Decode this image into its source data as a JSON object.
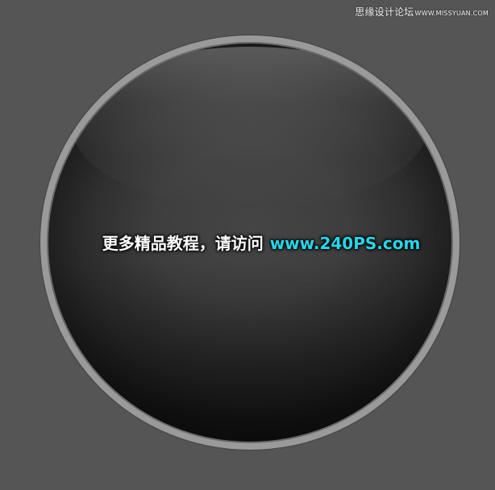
{
  "watermark": {
    "text": "思缘设计论坛",
    "domain": "WWW.MISSYUAN.COM"
  },
  "promo": {
    "text": "更多精品教程，请访问",
    "url": "www.240PS.com"
  },
  "colors": {
    "background": "#555555",
    "ring": "#9a9a9a",
    "orb_dark": "#1c1c1c",
    "url_accent": "#23d8ec",
    "promo_text": "#ffffff"
  }
}
